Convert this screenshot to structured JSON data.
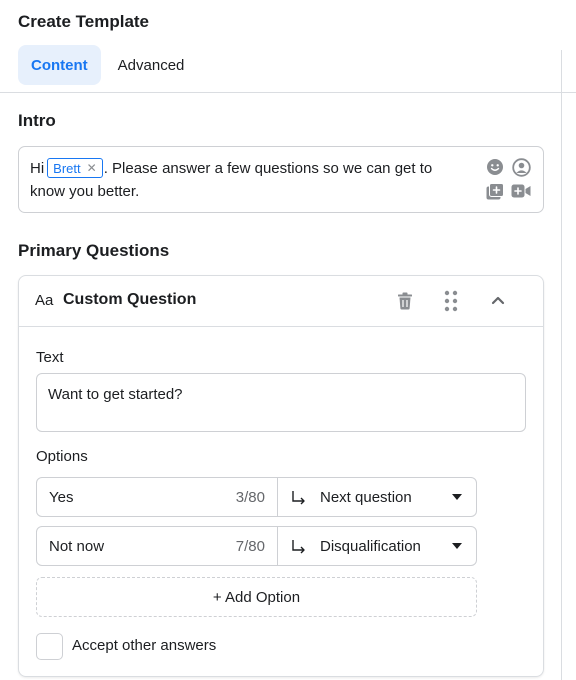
{
  "header": {
    "title": "Create Template",
    "tabs": [
      {
        "label": "Content",
        "active": true
      },
      {
        "label": "Advanced",
        "active": false
      }
    ]
  },
  "intro": {
    "section_title": "Intro",
    "text_before": "Hi",
    "name_chip": "Brett",
    "chip_remove": "✕",
    "text_after": ". Please answer a few questions so we can get to know you better.",
    "icons": [
      "emoji-icon",
      "profile-icon",
      "add-image-icon",
      "add-video-icon"
    ]
  },
  "primary_questions": {
    "section_title": "Primary Questions",
    "card": {
      "type_icon": "Aa",
      "title": "Custom Question",
      "text_label": "Text",
      "text_value": "Want to get started?",
      "options_label": "Options",
      "options": [
        {
          "value": "Yes",
          "count": "3/80",
          "route": "Next question"
        },
        {
          "value": "Not now",
          "count": "7/80",
          "route": "Disqualification"
        }
      ],
      "add_option_label": "+ Add Option",
      "accept_other_label": "Accept other answers",
      "accept_other_checked": false
    }
  },
  "colors": {
    "accent": "#1877f2",
    "active_tab_bg": "#e7f0fc",
    "border": "#ced0d4",
    "icon_gray": "#8a8d91"
  }
}
